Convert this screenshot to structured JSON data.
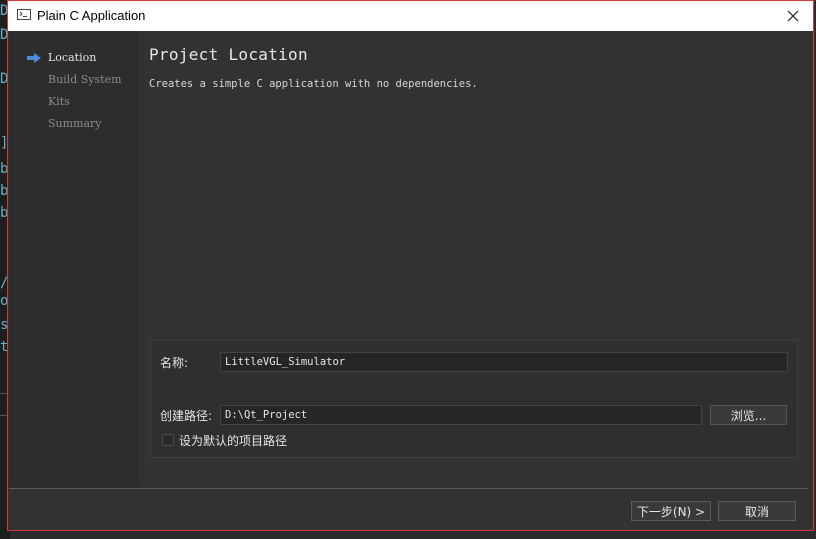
{
  "window": {
    "title": "Plain C Application",
    "close_glyph": "✕"
  },
  "background_editor": {
    "glyphs": [
      "D",
      "D",
      "D",
      "]",
      "b",
      "b",
      "b",
      "/",
      "o",
      "s",
      "t"
    ]
  },
  "sidebar": {
    "steps": [
      {
        "label": "Location",
        "active": true
      },
      {
        "label": "Build System",
        "active": false
      },
      {
        "label": "Kits",
        "active": false
      },
      {
        "label": "Summary",
        "active": false
      }
    ]
  },
  "main": {
    "title": "Project Location",
    "subtitle": "Creates a simple C application with no dependencies."
  },
  "form": {
    "name_label": "名称:",
    "name_value": "LittleVGL_Simulator",
    "path_label": "创建路径:",
    "path_value": "D:\\Qt_Project",
    "browse_label": "浏览...",
    "default_path_label": "设为默认的项目路径",
    "default_path_checked": false
  },
  "footer": {
    "next_label": "下一步(N) >",
    "cancel_label": "取消"
  },
  "colors": {
    "accent_arrow": "#4a90d9",
    "dialog_border": "#d33a3a",
    "dialog_bg": "#323232"
  }
}
